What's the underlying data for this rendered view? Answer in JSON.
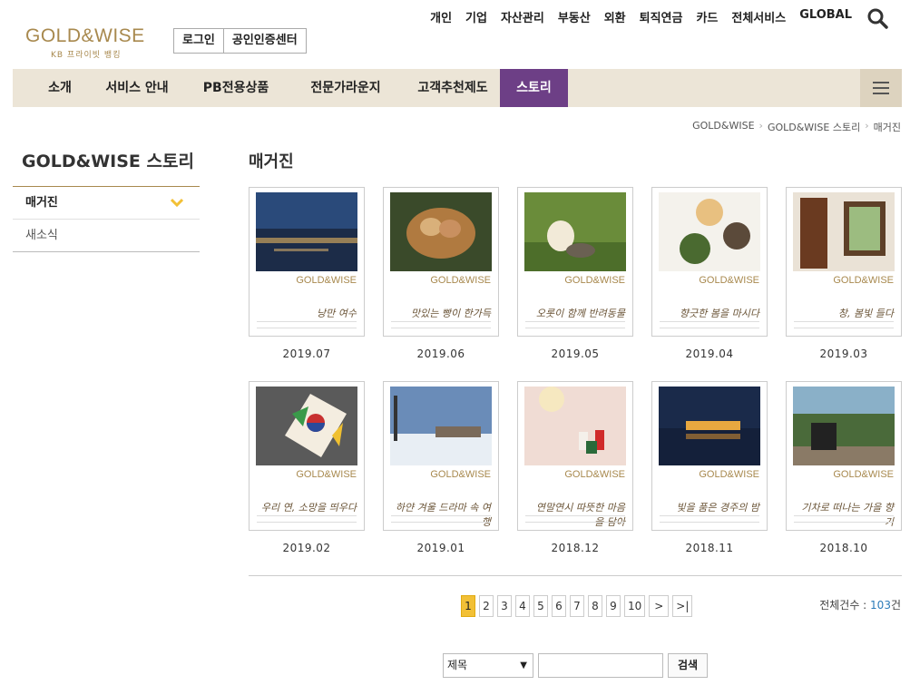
{
  "logo": {
    "main": "GOLD&WISE",
    "sub": "KB 프라이빗 뱅킹"
  },
  "auth": {
    "login": "로그인",
    "cert": "공인인증센터"
  },
  "topnav": [
    "개인",
    "기업",
    "자산관리",
    "부동산",
    "외환",
    "퇴직연금",
    "카드",
    "전체서비스",
    "GLOBAL"
  ],
  "gnb": [
    "소개",
    "서비스 안내",
    "PB전용상품",
    "전문가라운지",
    "고객추천제도",
    "스토리"
  ],
  "gnb_active_index": 5,
  "breadcrumb": [
    "GOLD&WISE",
    "GOLD&WISE 스토리",
    "매거진"
  ],
  "sidebar": {
    "title": "GOLD&WISE 스토리",
    "items": [
      "매거진",
      "새소식"
    ]
  },
  "main": {
    "title": "매거진"
  },
  "magazines": [
    {
      "date": "2019.07",
      "brand": "GOLD&WISE",
      "script": "낭만 여수",
      "icon": "night-harbor-photo"
    },
    {
      "date": "2019.06",
      "brand": "GOLD&WISE",
      "script": "맛있는 빵이 한가득",
      "icon": "bread-basket-photo"
    },
    {
      "date": "2019.05",
      "brand": "GOLD&WISE",
      "script": "오롯이 함께 반려동물",
      "icon": "puppy-kitten-photo"
    },
    {
      "date": "2019.04",
      "brand": "GOLD&WISE",
      "script": "향긋한 봄을 마시다",
      "icon": "tea-photo"
    },
    {
      "date": "2019.03",
      "brand": "GOLD&WISE",
      "script": "창, 봄빛 들다",
      "icon": "window-photo"
    },
    {
      "date": "2019.02",
      "brand": "GOLD&WISE",
      "script": "우리 연, 소망을 띄우다",
      "icon": "kite-photo"
    },
    {
      "date": "2019.01",
      "brand": "GOLD&WISE",
      "script": "하얀 겨울 드라마 속 여행",
      "icon": "snow-village-photo"
    },
    {
      "date": "2018.12",
      "brand": "GOLD&WISE",
      "script": "연말연시 따뜻한 마음을 담아",
      "icon": "candles-photo"
    },
    {
      "date": "2018.11",
      "brand": "GOLD&WISE",
      "script": "빛을 품은 경주의 밤",
      "icon": "palace-night-photo"
    },
    {
      "date": "2018.10",
      "brand": "GOLD&WISE",
      "script": "기차로 떠나는 가을 향기",
      "icon": "steam-train-photo"
    }
  ],
  "pagination": {
    "pages": [
      "1",
      "2",
      "3",
      "4",
      "5",
      "6",
      "7",
      "8",
      "9",
      "10"
    ],
    "current": "1",
    "next": ">",
    "last": ">|"
  },
  "total": {
    "label": "전체건수 : ",
    "count": "103",
    "unit": "건"
  },
  "search": {
    "field_selected": "제목",
    "button": "검색",
    "query": ""
  },
  "colors": {
    "gold": "#a8894e",
    "gnb_bg": "#ece5d7",
    "active_purple": "#6d3f86",
    "page_on": "#f2c036",
    "count_blue": "#2b7bb9"
  }
}
